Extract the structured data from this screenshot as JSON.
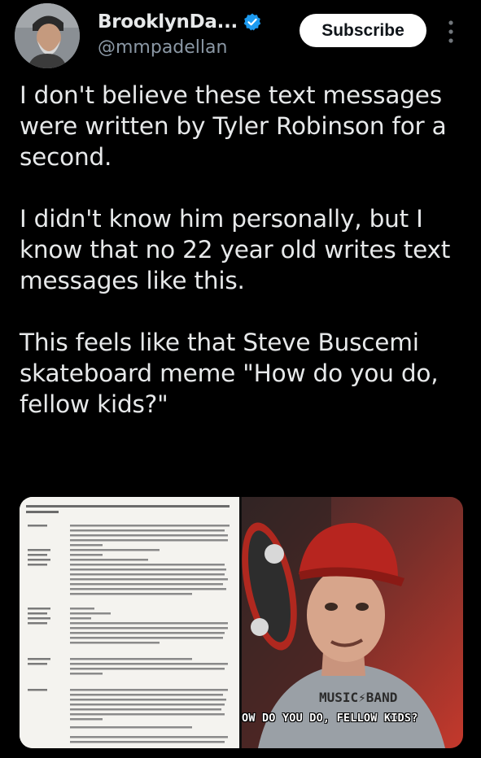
{
  "header": {
    "display_name": "BrooklynDa...",
    "handle": "@mmpadellan",
    "subscribe_label": "Subscribe",
    "verified_color": "#1d9bf0"
  },
  "tweet": {
    "paragraphs": [
      "I don't believe these text messages were written by Tyler Robinson for a second.",
      "I didn't know him personally, but I know that no 22 year old writes text messages like this.",
      "This feels like that Steve Buscemi skateboard meme \"How do you do, fellow kids?\""
    ]
  },
  "media": {
    "meme_caption": "OW DO YOU DO, FELLOW KIDS?",
    "shirt_text": "MUSIC⚡BAND"
  },
  "icons": {
    "verified": "verified-badge-icon",
    "more": "more-options-icon"
  }
}
